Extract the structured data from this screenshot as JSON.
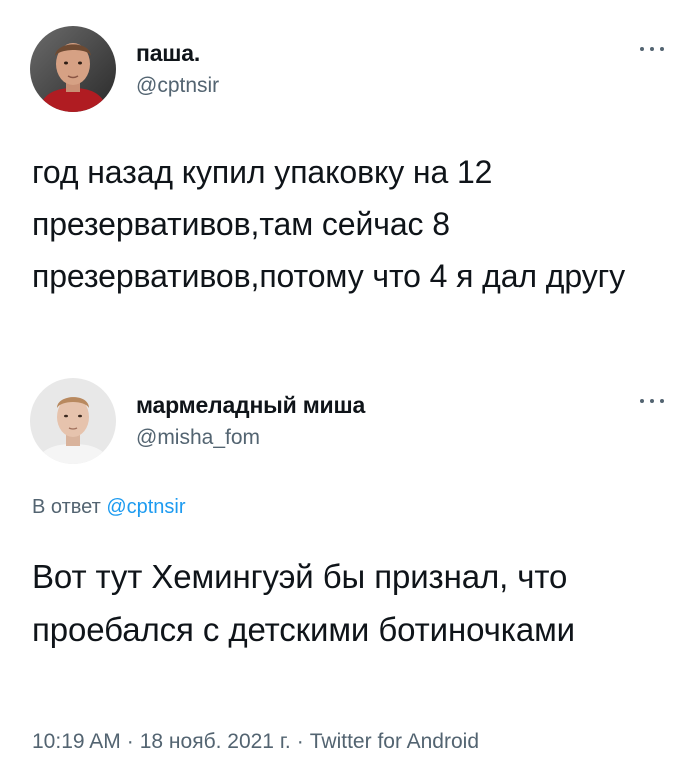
{
  "tweet": {
    "display_name": "паша.",
    "handle": "@cptnsir",
    "text": "год назад купил упаковку на 12 презервативов,там сейчас 8 презервативов,потому что 4 я дал другу"
  },
  "reply": {
    "display_name": "мармеладный миша",
    "handle": "@misha_fom",
    "reply_prefix": "В ответ",
    "reply_to": "@cptnsir",
    "text": "Вот тут Хемингуэй бы признал, что проебался с детскими ботиночками",
    "time": "10:19 AM",
    "date": "18 нояб. 2021 г.",
    "source": "Twitter for Android",
    "separator": "·"
  },
  "icons": {
    "more": "more-options-icon",
    "avatar_one": "avatar",
    "avatar_two": "avatar"
  },
  "colors": {
    "text_primary": "#0f1419",
    "text_secondary": "#536471",
    "mention": "#1d9bf0",
    "background": "#ffffff"
  }
}
